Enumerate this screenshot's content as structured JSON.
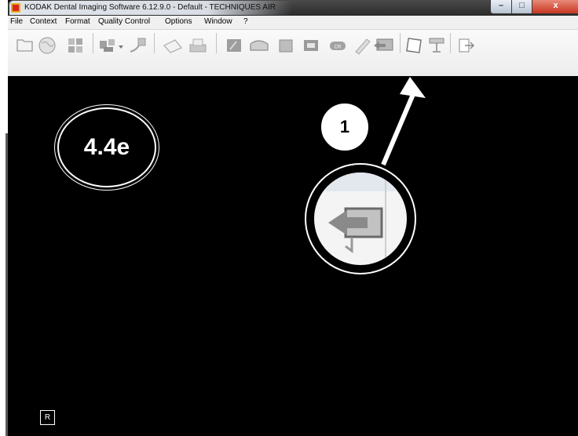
{
  "window": {
    "title": "KODAK Dental Imaging Software 6.12.9.0 - Default  - TECHNIQUES AIR",
    "controls": {
      "minimize": "–",
      "maximize": "□",
      "close": "x"
    }
  },
  "menu": {
    "items": [
      "File",
      "Context",
      "Format",
      "Quality Control",
      "Options",
      "Window",
      "?"
    ]
  },
  "toolbar": {
    "icons": [
      "open-folder-icon",
      "globe-icon",
      "grid-icon",
      "acquire-icon",
      "dropdown-arrow-icon",
      "device-icon",
      "email-icon",
      "print-icon",
      "intraoral-icon",
      "panoramic-icon",
      "cephalometric-icon",
      "sensor-icon",
      "cr-icon",
      "pen-icon",
      "export-icon",
      "frame-icon",
      "stand-icon",
      "exit-icon"
    ]
  },
  "annotation": {
    "step_label": "4.4e",
    "callout_number": "1"
  },
  "canvas": {
    "corner_label": "R"
  },
  "colors": {
    "canvas_bg": "#000000",
    "titlebar": "#2a2a2a",
    "close_button": "#c8361f"
  }
}
